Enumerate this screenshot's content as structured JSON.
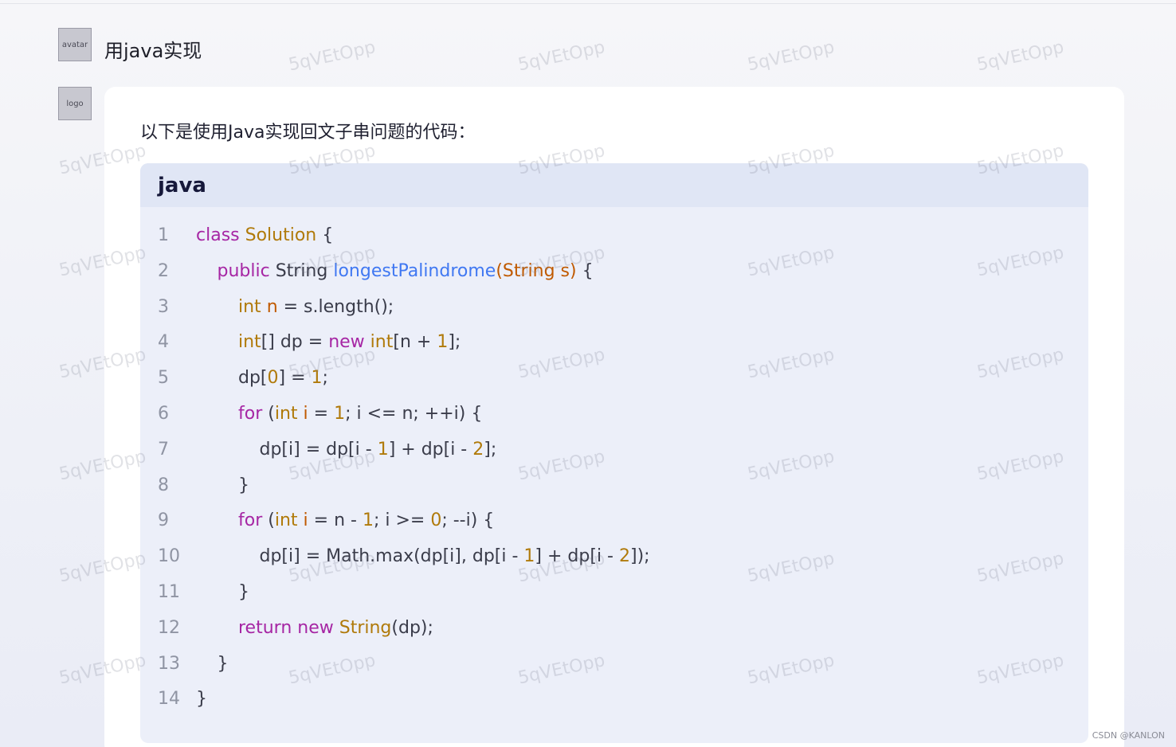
{
  "conversation": {
    "user_message": "用java实现",
    "assistant_intro": "以下是使用Java实现回文子串问题的代码：",
    "code_language": "java"
  },
  "code_lines": [
    {
      "n": "1",
      "indent": 0,
      "tokens": [
        {
          "t": "class ",
          "c": "kw"
        },
        {
          "t": "Solution",
          "c": "ty"
        },
        {
          "t": " {",
          "c": ""
        }
      ]
    },
    {
      "n": "2",
      "indent": 1,
      "tokens": [
        {
          "t": "public ",
          "c": "kw"
        },
        {
          "t": "String ",
          "c": ""
        },
        {
          "t": "longestPalindrome",
          "c": "fn"
        },
        {
          "t": "(String s)",
          "c": "pm"
        },
        {
          "t": " {",
          "c": ""
        }
      ]
    },
    {
      "n": "3",
      "indent": 2,
      "tokens": [
        {
          "t": "int ",
          "c": "ty"
        },
        {
          "t": "n",
          "c": "pm"
        },
        {
          "t": " = s.length();",
          "c": ""
        }
      ]
    },
    {
      "n": "4",
      "indent": 2,
      "tokens": [
        {
          "t": "int",
          "c": "ty"
        },
        {
          "t": "[] dp = ",
          "c": ""
        },
        {
          "t": "new ",
          "c": "kw"
        },
        {
          "t": "int",
          "c": "ty"
        },
        {
          "t": "[n + ",
          "c": ""
        },
        {
          "t": "1",
          "c": "num"
        },
        {
          "t": "];",
          "c": ""
        }
      ]
    },
    {
      "n": "5",
      "indent": 2,
      "tokens": [
        {
          "t": "dp[",
          "c": ""
        },
        {
          "t": "0",
          "c": "num"
        },
        {
          "t": "] = ",
          "c": ""
        },
        {
          "t": "1",
          "c": "num"
        },
        {
          "t": ";",
          "c": ""
        }
      ]
    },
    {
      "n": "6",
      "indent": 2,
      "tokens": [
        {
          "t": "for ",
          "c": "kw"
        },
        {
          "t": "(",
          "c": ""
        },
        {
          "t": "int ",
          "c": "ty"
        },
        {
          "t": "i",
          "c": "pm"
        },
        {
          "t": " = ",
          "c": ""
        },
        {
          "t": "1",
          "c": "num"
        },
        {
          "t": "; i <= n; ++i) {",
          "c": ""
        }
      ]
    },
    {
      "n": "7",
      "indent": 3,
      "tokens": [
        {
          "t": "dp[i] = dp[i - ",
          "c": ""
        },
        {
          "t": "1",
          "c": "num"
        },
        {
          "t": "] + dp[i - ",
          "c": ""
        },
        {
          "t": "2",
          "c": "num"
        },
        {
          "t": "];",
          "c": ""
        }
      ]
    },
    {
      "n": "8",
      "indent": 2,
      "tokens": [
        {
          "t": "}",
          "c": ""
        }
      ]
    },
    {
      "n": "9",
      "indent": 2,
      "tokens": [
        {
          "t": "for ",
          "c": "kw"
        },
        {
          "t": "(",
          "c": ""
        },
        {
          "t": "int ",
          "c": "ty"
        },
        {
          "t": "i",
          "c": "pm"
        },
        {
          "t": " = n - ",
          "c": ""
        },
        {
          "t": "1",
          "c": "num"
        },
        {
          "t": "; i >= ",
          "c": ""
        },
        {
          "t": "0",
          "c": "num"
        },
        {
          "t": "; --i) {",
          "c": ""
        }
      ]
    },
    {
      "n": "10",
      "indent": 3,
      "tokens": [
        {
          "t": "dp[i] = Math.max(dp[i], dp[i - ",
          "c": ""
        },
        {
          "t": "1",
          "c": "num"
        },
        {
          "t": "] + dp[i - ",
          "c": ""
        },
        {
          "t": "2",
          "c": "num"
        },
        {
          "t": "]);",
          "c": ""
        }
      ]
    },
    {
      "n": "11",
      "indent": 2,
      "tokens": [
        {
          "t": "}",
          "c": ""
        }
      ]
    },
    {
      "n": "12",
      "indent": 2,
      "tokens": [
        {
          "t": "return ",
          "c": "kw"
        },
        {
          "t": "new ",
          "c": "kw"
        },
        {
          "t": "String",
          "c": "ty"
        },
        {
          "t": "(dp);",
          "c": ""
        }
      ]
    },
    {
      "n": "13",
      "indent": 1,
      "tokens": [
        {
          "t": "}",
          "c": ""
        }
      ]
    },
    {
      "n": "14",
      "indent": 0,
      "tokens": [
        {
          "t": "}",
          "c": ""
        }
      ]
    }
  ],
  "watermark_text": "5qVEtOpp",
  "credit": "CSDN @KANLON",
  "icons": {
    "user_avatar": "user-avatar-photo",
    "assistant_avatar": "assistant-cube-logo-icon"
  },
  "colors": {
    "keyword": "#a626a4",
    "type": "#b07a0a",
    "function": "#4078f2",
    "param": "#c05a00",
    "avatar_gradient_start": "#5b8cff",
    "avatar_gradient_end": "#6a5cf6"
  }
}
